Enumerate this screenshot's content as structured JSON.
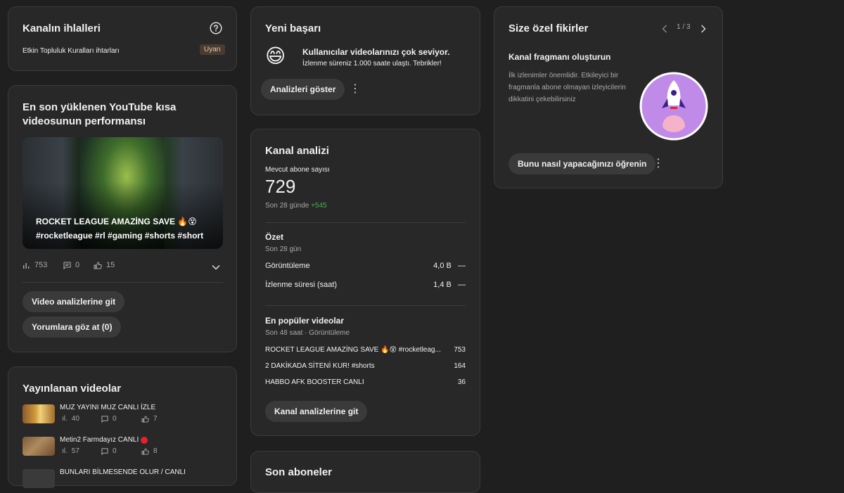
{
  "violations": {
    "title": "Kanalın ihlalleri",
    "help_icon": "help-circle-icon",
    "item_label": "Etkin Topluluk Kuralları ihtarları",
    "badge": "Uyarı"
  },
  "shorts": {
    "title": "En son yüklenen YouTube kısa videosunun performansı",
    "video_title": "ROCKET LEAGUE AMAZİNG SAVE 🔥😵 #rocketleague #rl #gaming #shorts #short",
    "views": "753",
    "comments": "0",
    "likes": "15",
    "btn_analytics": "Video analizlerine git",
    "btn_comments": "Yorumlara göz at (0)"
  },
  "published": {
    "title": "Yayınlanan videolar",
    "items": [
      {
        "title": "MUZ YAYINI MUZ CANLI İZLE",
        "views": "40",
        "comments": "0",
        "likes": "7"
      },
      {
        "title": "Metin2 Farmdayız CANLI",
        "views": "57",
        "comments": "0",
        "likes": "8",
        "live_dot_color": "#e8202a"
      },
      {
        "title": "BUNLARI BİLMESENDE OLUR / CANLI",
        "views": "",
        "comments": "",
        "likes": ""
      }
    ]
  },
  "achievement": {
    "title": "Yeni başarı",
    "headline": "Kullanıcılar videolarınızı çok seviyor.",
    "subline": "İzlenme süreniz 1.000 saate ulaştı. Tebrikler!",
    "button": "Analizleri göster",
    "emoji": "😄"
  },
  "analytics": {
    "title": "Kanal analizi",
    "subs_label": "Mevcut abone sayısı",
    "subs_value": "729",
    "subs_period": "Son 28 günde",
    "subs_delta": "+545",
    "summary_title": "Özet",
    "summary_period": "Son 28 gün",
    "summary_rows": [
      {
        "label": "Görüntüleme",
        "value": "4,0 B",
        "trend": "—"
      },
      {
        "label": "İzlenme süresi (saat)",
        "value": "1,4 B",
        "trend": "—"
      }
    ],
    "top_title": "En popüler videolar",
    "top_period": "Son 48 saat · Görüntüleme",
    "top_rows": [
      {
        "label": "ROCKET LEAGUE AMAZİNG SAVE 🔥😵 #rocketleag...",
        "value": "753"
      },
      {
        "label": "2 DAKİKADA SİTENİ KUR! #shorts",
        "value": "164"
      },
      {
        "label": "HABBO AFK BOOSTER CANLI",
        "value": "36"
      }
    ],
    "button": "Kanal analizlerine git"
  },
  "subscribers": {
    "title": "Son aboneler"
  },
  "ideas": {
    "title": "Size özel fikirler",
    "pager": "1 / 3",
    "heading": "Kanal fragmanı oluşturun",
    "body": "İlk izlenimler önemlidir. Etkileyici bir fragmanla abone olmayan izleyicilerin dikkatini çekebilirsiniz",
    "button": "Bunu nasıl yapacağınızı öğrenin",
    "illustration_icon": "rocket-icon",
    "illustration_bg": "#c08ae8"
  }
}
